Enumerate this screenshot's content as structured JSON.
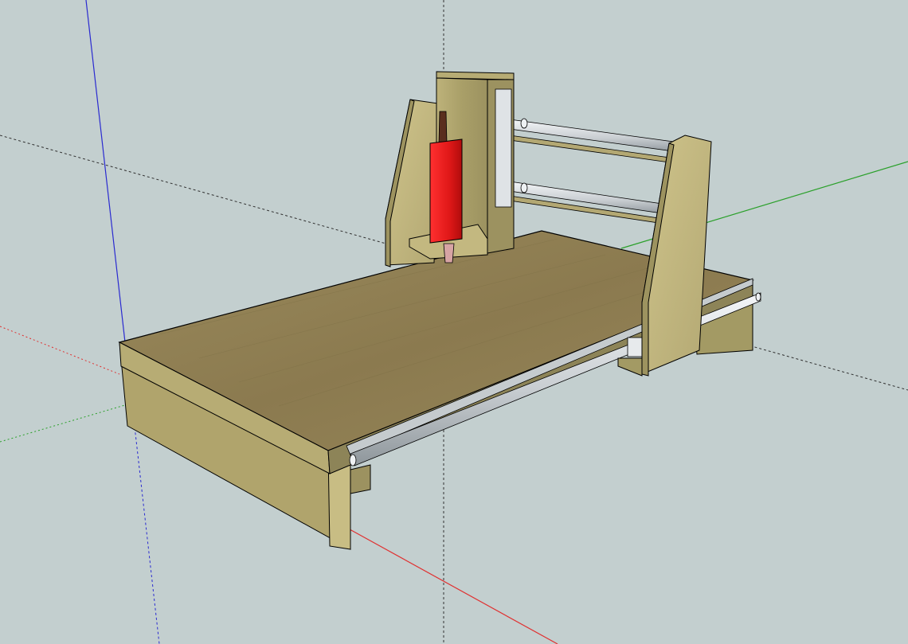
{
  "viewport": {
    "background": "#c3cfcf"
  },
  "axes": {
    "red": "#e03030",
    "green": "#2aa02a",
    "blue": "#2a2ad0",
    "dashed": "#303030"
  },
  "materials": {
    "wood_top": "#8f7d52",
    "wood_face": "#a99f68",
    "wood_light": "#c9bf86",
    "wood_dark": "#6e6440",
    "rail": "#dfe3e6",
    "rail_shadow": "#8d959a",
    "spindle": "#e01818",
    "spindle_dark": "#a00808",
    "collet": "#5a2e1e",
    "bit": "#d7a4a4",
    "edge": "#000000"
  }
}
